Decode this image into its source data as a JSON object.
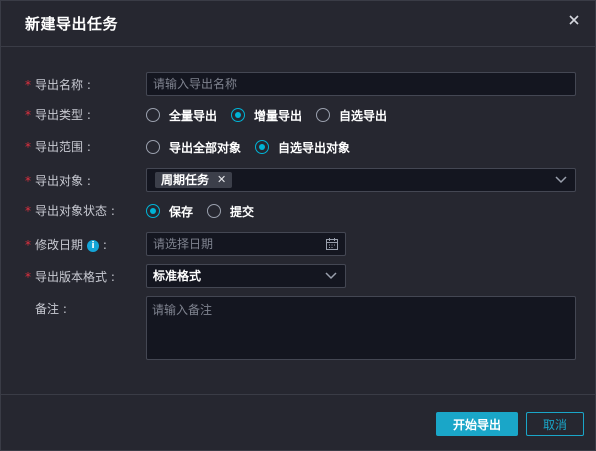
{
  "dialog": {
    "title": "新建导出任务"
  },
  "form": {
    "name": {
      "label": "导出名称",
      "placeholder": "请输入导出名称",
      "value": ""
    },
    "type": {
      "label": "导出类型",
      "options": [
        "全量导出",
        "增量导出",
        "自选导出"
      ],
      "selected": "增量导出"
    },
    "range": {
      "label": "导出范围",
      "options": [
        "导出全部对象",
        "自选导出对象"
      ],
      "selected": "自选导出对象"
    },
    "objects": {
      "label": "导出对象",
      "tags": [
        "周期任务"
      ]
    },
    "status": {
      "label": "导出对象状态",
      "options": [
        "保存",
        "提交"
      ],
      "selected": "保存"
    },
    "date": {
      "label": "修改日期",
      "placeholder": "请选择日期"
    },
    "format": {
      "label": "导出版本格式",
      "value": "标准格式"
    },
    "remark": {
      "label": "备注",
      "placeholder": "请输入备注"
    }
  },
  "footer": {
    "confirm_label": "开始导出",
    "cancel_label": "取消"
  },
  "colors": {
    "accent": "#1aa6c8",
    "required": "#e0303e",
    "radio_on": "#00b4d6"
  }
}
